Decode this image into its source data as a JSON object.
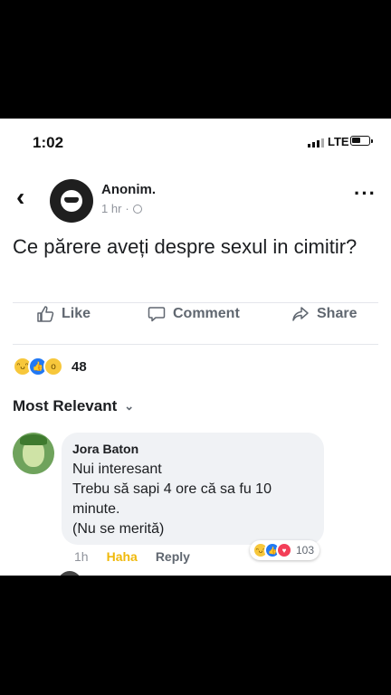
{
  "status_bar": {
    "time": "1:02",
    "network": "LTE"
  },
  "post": {
    "author": "Anonim.",
    "time": "1 hr",
    "separator": "·",
    "text": "Ce părere aveți despre sexul in cimitir?",
    "actions": {
      "like": "Like",
      "comment": "Comment",
      "share": "Share"
    },
    "reaction_count": "48"
  },
  "comments_section": {
    "sort_label": "Most Relevant"
  },
  "comment": {
    "author": "Jora Baton",
    "text": "Nui interesant\nTrebu să sapi 4 ore că sa fu 10\nminute.\n(Nu se merită)",
    "time": "1h",
    "haha_label": "Haha",
    "reply_label": "Reply",
    "reaction_count": "103"
  },
  "icons": {
    "back": "back-chevron-icon",
    "more": "more-dots-icon",
    "globe": "globe-icon",
    "like": "thumbs-up-icon",
    "comment": "comment-bubble-icon",
    "share": "share-arrow-icon"
  },
  "colors": {
    "like_blue": "#2078f4",
    "haha_yellow": "#f7c73b",
    "love_red": "#f33e58",
    "secondary_text": "#606770"
  }
}
